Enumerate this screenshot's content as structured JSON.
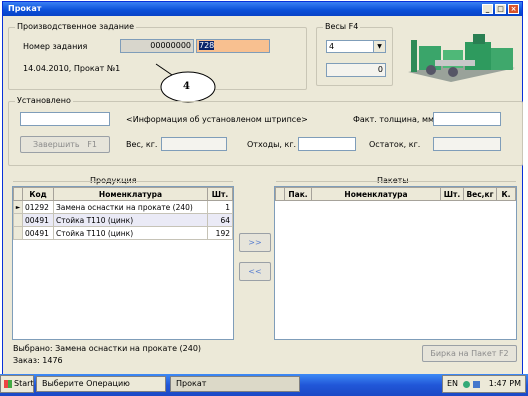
{
  "window": {
    "title": "Прокат"
  },
  "task_group": {
    "title": "Производственное задание",
    "number_label": "Номер задания",
    "number_value": "00000000",
    "number_suffix": "728",
    "date_text": "14.04.2010, Прокат №1",
    "callout": "4"
  },
  "scales": {
    "title": "Весы  F4",
    "selected": "4",
    "weight": "0"
  },
  "installed": {
    "title": "Установлено",
    "info_text": "<Информация об установленом штрипсе>",
    "thickness_label": "Факт. толщина, мм.",
    "finish_button": "Завершить",
    "finish_key": "F1",
    "weight_label": "Вес, кг.",
    "waste_label": "Отходы, кг.",
    "remainder_label": "Остаток, кг."
  },
  "products": {
    "title": "Продукция",
    "columns": [
      "Код",
      "Номенклатура",
      "Шт."
    ],
    "rows": [
      {
        "code": "01292",
        "name": "Замена оснастки на прокате (240)",
        "qty": "1"
      },
      {
        "code": "00491",
        "name": "Стойка Т110 (цинк)",
        "qty": "64"
      },
      {
        "code": "00491",
        "name": "Стойка Т110 (цинк)",
        "qty": "192"
      }
    ]
  },
  "packages": {
    "title": "Пакеты",
    "columns": [
      "Пак.",
      "Номенклатура",
      "Шт.",
      "Вес,кг",
      "К."
    ]
  },
  "transfer": {
    "forward": ">>",
    "back": "<<"
  },
  "footer": {
    "selected_text": "Выбрано: Замена оснастки на прокате (240)",
    "order_text": "Заказ: 1476",
    "tag_button": "Бирка на Пакет  F2"
  },
  "taskbar": {
    "start": "Start",
    "item1": "Выберите Операцию",
    "item2": "Прокат",
    "lang": "EN",
    "time": "1:47 PM"
  },
  "colors": {
    "title_bar": "#0a4fd8",
    "highlight_input": "#f8c090",
    "selection": "#0a246a"
  }
}
